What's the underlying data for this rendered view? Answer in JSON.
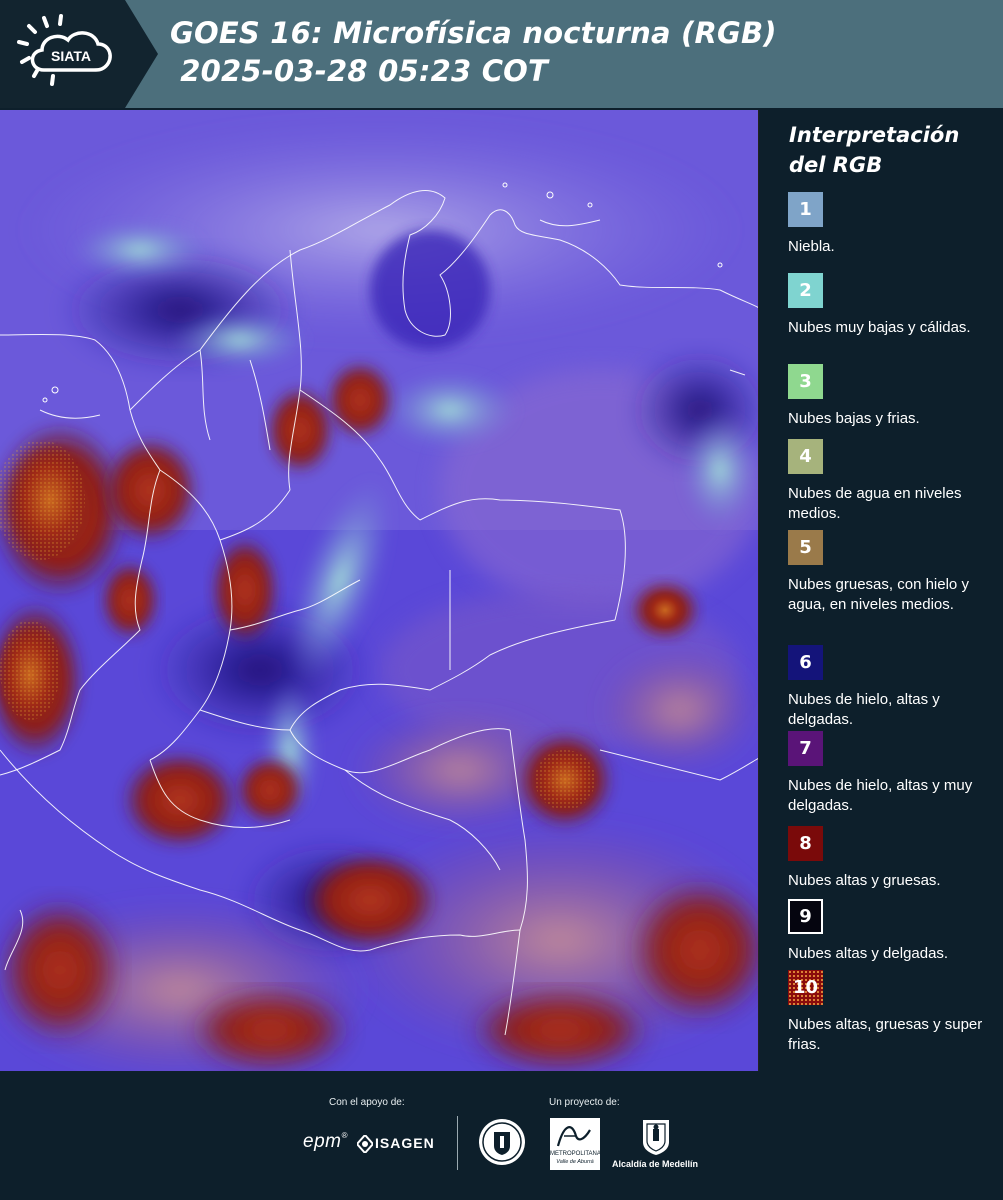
{
  "header": {
    "logo_text": "SIATA",
    "title_line1": "GOES 16: Microfísica nocturna (RGB)",
    "title_line2": " 2025-03-28 05:23 COT"
  },
  "map": {
    "description_icon": "satellite-rgb-image"
  },
  "legend": {
    "title": "Interpretación del RGB",
    "items": [
      {
        "number": "1",
        "label": "Niebla.",
        "color": "#7fa4c8"
      },
      {
        "number": "2",
        "label": "Nubes muy bajas y cálidas.",
        "color": "#7fd4d0"
      },
      {
        "number": "3",
        "label": "Nubes bajas y frias.",
        "color": "#8fd88f"
      },
      {
        "number": "4",
        "label": "Nubes de agua en niveles medios.",
        "color": "#a6b37c"
      },
      {
        "number": "5",
        "label": "Nubes gruesas, con hielo y agua, en niveles medios.",
        "color": "#9a7a4a"
      },
      {
        "number": "6",
        "label": "Nubes de hielo, altas y delgadas.",
        "color": "#14147a"
      },
      {
        "number": "7",
        "label": "Nubes de hielo, altas y muy delgadas.",
        "color": "#5a1478"
      },
      {
        "number": "8",
        "label": "Nubes altas y gruesas.",
        "color": "#7a0a0a"
      },
      {
        "number": "9",
        "label": "Nubes altas y delgadas.",
        "color": "#05050f"
      },
      {
        "number": "10",
        "label": "Nubes altas, gruesas y super frias.",
        "color": "#8a0c0c"
      }
    ]
  },
  "footer": {
    "support_caption": "Con el apoyo de:",
    "project_caption": "Un proyecto de:",
    "sponsor1": "epm",
    "sponsor2": "ISAGEN",
    "partner_metro_1": "METROPOLITANA",
    "partner_metro_2": "Valle de Aburrá",
    "partner_alcaldia": "Alcaldía de Medellín"
  }
}
